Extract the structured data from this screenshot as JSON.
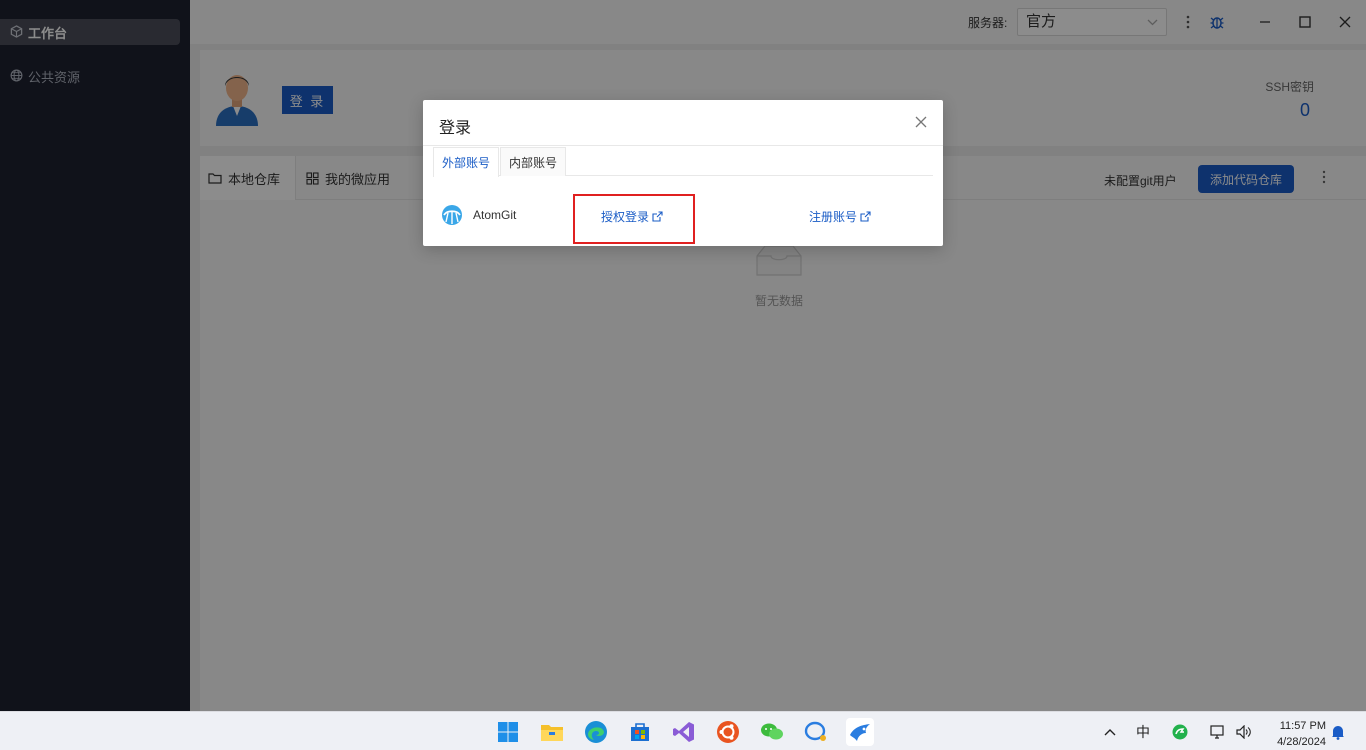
{
  "sidebar": {
    "items": [
      {
        "label": "工作台",
        "icon": "cube-icon",
        "active": true
      },
      {
        "label": "公共资源",
        "icon": "globe-icon",
        "active": false
      }
    ]
  },
  "topbar": {
    "server_label": "服务器:",
    "server_value": "官方"
  },
  "profile": {
    "login_label": "登 录",
    "ssh_label": "SSH密钥",
    "ssh_count": "0"
  },
  "repo": {
    "tabs": [
      {
        "label": "本地仓库",
        "icon": "folder-icon"
      },
      {
        "label": "我的微应用",
        "icon": "grid-icon"
      }
    ],
    "git_user": "未配置git用户",
    "add_repo_label": "添加代码仓库",
    "empty_text": "暂无数据"
  },
  "modal": {
    "title": "登录",
    "tabs": [
      {
        "label": "外部账号",
        "active": true
      },
      {
        "label": "内部账号",
        "active": false
      }
    ],
    "provider": "AtomGit",
    "auth_link": "授权登录",
    "register_link": "注册账号"
  },
  "taskbar": {
    "ime": "中",
    "time": "11:57 PM",
    "date": "4/28/2024"
  },
  "colors": {
    "accent": "#1a5cc6",
    "sidebar_bg": "#1e2130",
    "highlight_box": "#e02020"
  }
}
